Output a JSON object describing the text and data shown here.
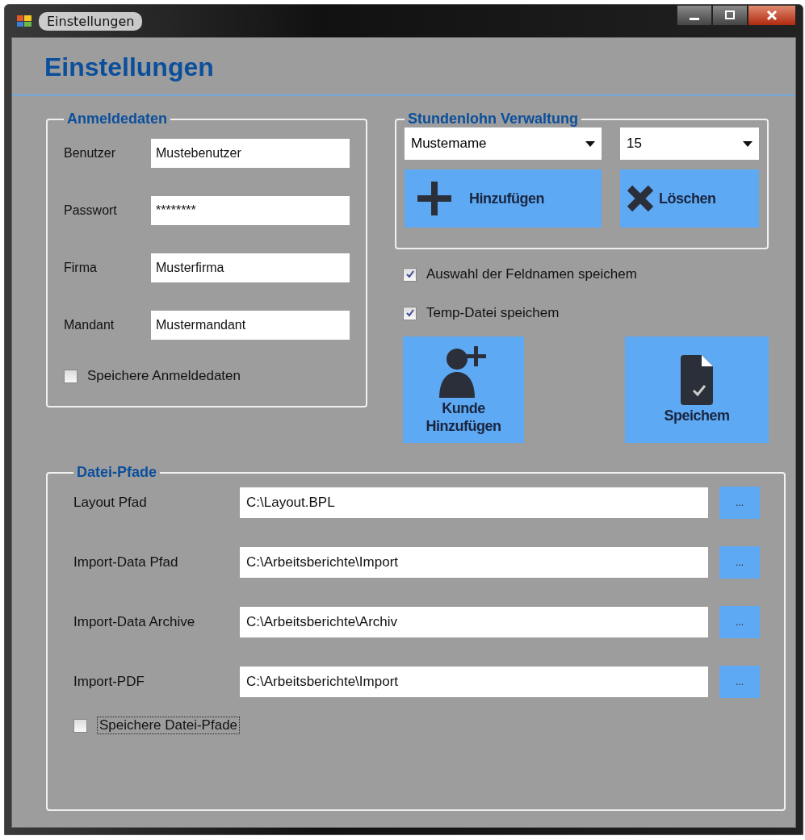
{
  "window": {
    "title": "Einstellungen"
  },
  "heading": "Einstellungen",
  "login": {
    "title": "Anmeldedaten",
    "fields": [
      {
        "label": "Benutzer",
        "value": "Mustebenutzer"
      },
      {
        "label": "Passwort",
        "value": "********"
      },
      {
        "label": "Firma",
        "value": "Musterfirma"
      },
      {
        "label": "Mandant",
        "value": "Mustermandant"
      }
    ],
    "save_checkbox": {
      "label": "Speichere Anmeldedaten",
      "checked": false
    }
  },
  "wage": {
    "title": "Stundenlohn Verwaltung",
    "name_select": "Mustemame",
    "rate_select": "15",
    "add_button": "Hinzufügen",
    "delete_button": "Löschen"
  },
  "options": [
    {
      "label": "Auswahl der Feldnamen speichem",
      "checked": true
    },
    {
      "label": "Temp-Datei speichem",
      "checked": true
    }
  ],
  "actions": {
    "add_customer": "Kunde Hinzufügen",
    "save": "Speichem"
  },
  "paths": {
    "title": "Datei-Pfade",
    "rows": [
      {
        "label": "Layout Pfad",
        "value": "C:\\Layout.BPL",
        "button": "..."
      },
      {
        "label": "Import-Data Pfad",
        "value": "C:\\Arbeitsberichte\\Import",
        "button": "..."
      },
      {
        "label": "Import-Data Archive",
        "value": "C:\\Arbeitsberichte\\Archiv",
        "button": "..."
      },
      {
        "label": "Import-PDF",
        "value": "C:\\Arbeitsberichte\\Import",
        "button": "..."
      }
    ],
    "save_checkbox": {
      "label": "Speichere Datei-Pfade",
      "checked": false
    }
  }
}
